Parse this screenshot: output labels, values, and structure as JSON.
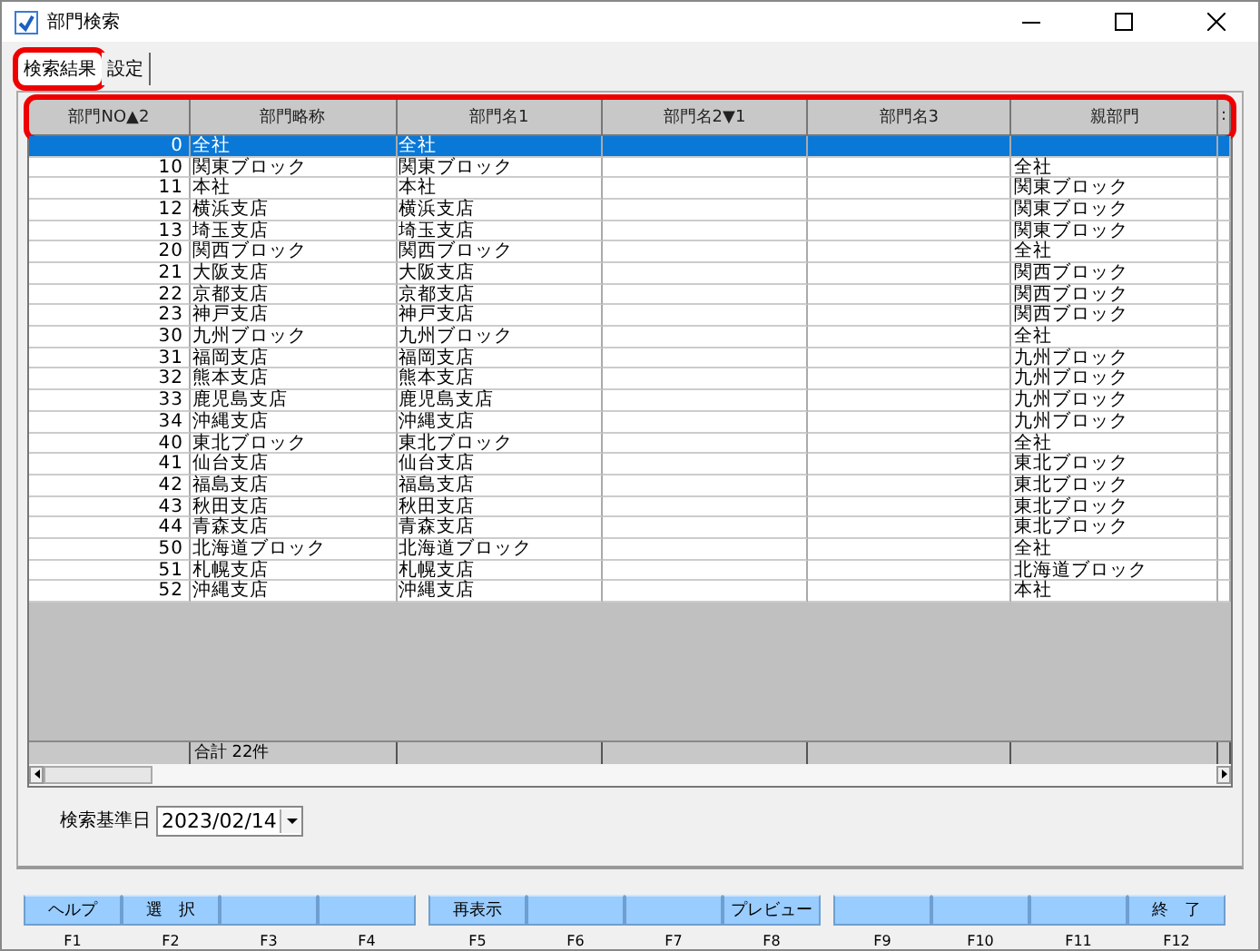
{
  "window": {
    "title": "部門検索"
  },
  "tabs": [
    {
      "label": "検索結果",
      "selected": true,
      "highlighted": true
    },
    {
      "label": "設定",
      "selected": false,
      "highlighted": false
    }
  ],
  "table": {
    "highlighted": true,
    "columns": [
      "部門NO▲2",
      "部門略称",
      "部門名1",
      "部門名2▼1",
      "部門名3",
      "親部門",
      ":"
    ],
    "rows": [
      {
        "no": "0",
        "short": "全社",
        "name1": "全社",
        "selected": true
      },
      {
        "no": "10",
        "short": "関東ブロック",
        "name1": "関東ブロック",
        "parent": "全社",
        "selected": false
      },
      {
        "no": "11",
        "short": "本社",
        "name1": "本社",
        "parent": "関東ブロック",
        "selected": false
      },
      {
        "no": "12",
        "short": "横浜支店",
        "name1": "横浜支店",
        "parent": "関東ブロック",
        "selected": false
      },
      {
        "no": "13",
        "short": "埼玉支店",
        "name1": "埼玉支店",
        "parent": "関東ブロック",
        "selected": false
      },
      {
        "no": "20",
        "short": "関西ブロック",
        "name1": "関西ブロック",
        "parent": "全社",
        "selected": false
      },
      {
        "no": "21",
        "short": "大阪支店",
        "name1": "大阪支店",
        "parent": "関西ブロック",
        "selected": false
      },
      {
        "no": "22",
        "short": "京都支店",
        "name1": "京都支店",
        "parent": "関西ブロック",
        "selected": false
      },
      {
        "no": "23",
        "short": "神戸支店",
        "name1": "神戸支店",
        "parent": "関西ブロック",
        "selected": false
      },
      {
        "no": "30",
        "short": "九州ブロック",
        "name1": "九州ブロック",
        "parent": "全社",
        "selected": false
      },
      {
        "no": "31",
        "short": "福岡支店",
        "name1": "福岡支店",
        "parent": "九州ブロック",
        "selected": false
      },
      {
        "no": "32",
        "short": "熊本支店",
        "name1": "熊本支店",
        "parent": "九州ブロック",
        "selected": false
      },
      {
        "no": "33",
        "short": "鹿児島支店",
        "name1": "鹿児島支店",
        "parent": "九州ブロック",
        "selected": false
      },
      {
        "no": "34",
        "short": "沖縄支店",
        "name1": "沖縄支店",
        "parent": "九州ブロック",
        "selected": false
      },
      {
        "no": "40",
        "short": "東北ブロック",
        "name1": "東北ブロック",
        "parent": "全社",
        "selected": false
      },
      {
        "no": "41",
        "short": "仙台支店",
        "name1": "仙台支店",
        "parent": "東北ブロック",
        "selected": false
      },
      {
        "no": "42",
        "short": "福島支店",
        "name1": "福島支店",
        "parent": "東北ブロック",
        "selected": false
      },
      {
        "no": "43",
        "short": "秋田支店",
        "name1": "秋田支店",
        "parent": "東北ブロック",
        "selected": false
      },
      {
        "no": "44",
        "short": "青森支店",
        "name1": "青森支店",
        "parent": "東北ブロック",
        "selected": false
      },
      {
        "no": "50",
        "short": "北海道ブロック",
        "name1": "北海道ブロック",
        "parent": "全社",
        "selected": false
      },
      {
        "no": "51",
        "short": "札幌支店",
        "name1": "札幌支店",
        "parent": "北海道ブロック",
        "selected": false
      },
      {
        "no": "52",
        "short": "沖縄支店",
        "name1": "沖縄支店",
        "parent": "本社",
        "selected": false
      }
    ],
    "total": "合計 22件"
  },
  "date_filter": {
    "label": "検索基準日",
    "value": "2023/02/14"
  },
  "function_keys": [
    {
      "label": "ヘルプ",
      "key": "F1"
    },
    {
      "label": "選　択",
      "key": "F2"
    },
    {
      "key": "F3"
    },
    {
      "key": "F4"
    },
    {
      "label": "再表示",
      "key": "F5"
    },
    {
      "key": "F6"
    },
    {
      "key": "F7"
    },
    {
      "label": "プレビュー",
      "key": "F8"
    },
    {
      "key": "F9"
    },
    {
      "key": "F10"
    },
    {
      "key": "F11"
    },
    {
      "label": "終　了",
      "key": "F12"
    }
  ]
}
